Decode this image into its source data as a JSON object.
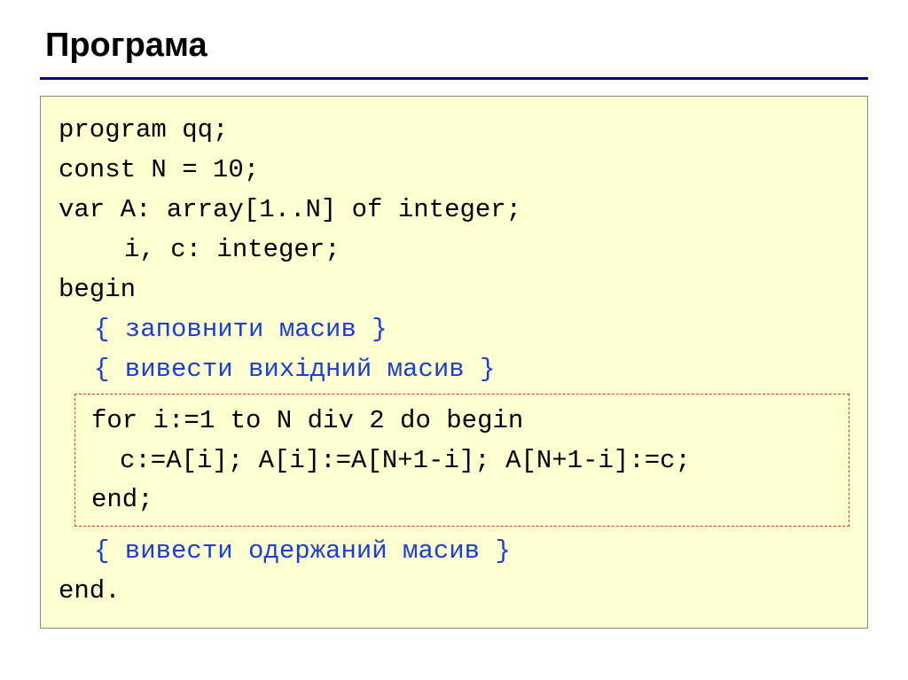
{
  "title": "Програма",
  "code": {
    "l1": "program qq;",
    "l2": "const N = 10;",
    "l3": "var A: array[1..N] of integer;",
    "l4": "i, c: integer;",
    "l5": "begin",
    "c1": "{ заповнити масив }",
    "c2": "{ вивести вихідний масив }",
    "l6": "for i:=1 to N div 2 do begin",
    "l7": "c:=A[i]; A[i]:=A[N+1-i]; A[N+1-i]:=c;",
    "l8": "end;",
    "c3": "{ вивести одержаний масив }",
    "l9": "end."
  }
}
